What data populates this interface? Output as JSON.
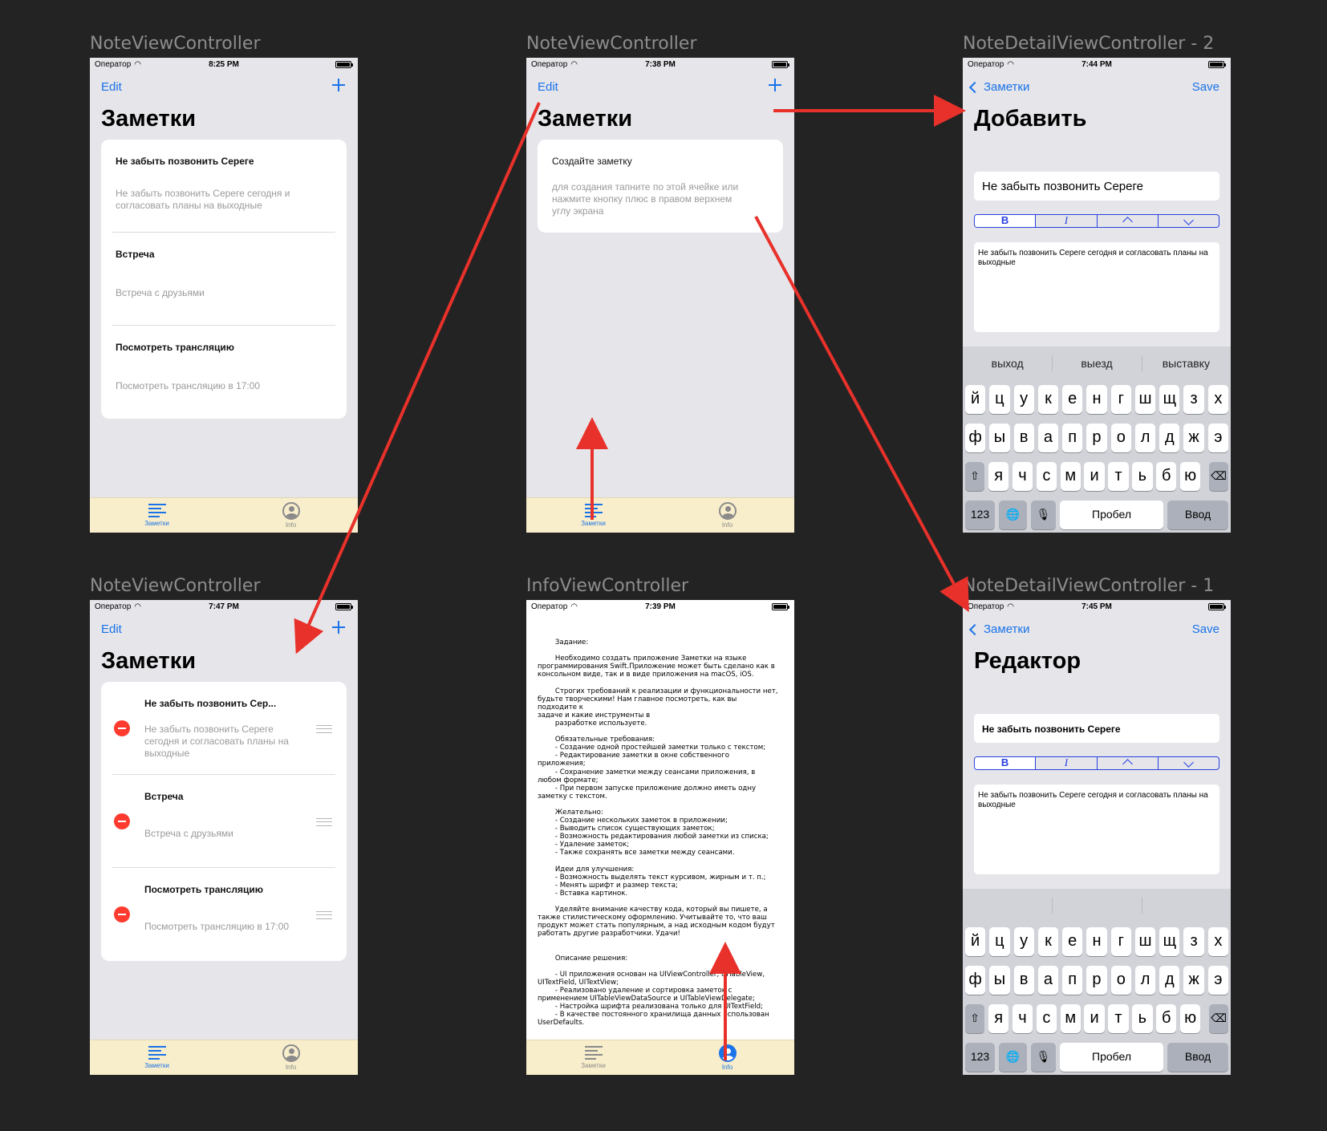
{
  "frames": {
    "f1": "NoteViewController",
    "f2": "NoteViewController",
    "f3": "NoteDetailViewController - 2",
    "f4": "NoteViewController",
    "f5": "InfoViewController",
    "f6": "NoteDetailViewController - 1"
  },
  "carrier": "Оператор",
  "times": {
    "s1": "8:25 PM",
    "s2": "7:38 PM",
    "s3": "7:44 PM",
    "s4": "7:47 PM",
    "s5": "7:39 PM",
    "s6": "7:45 PM"
  },
  "nav": {
    "edit": "Edit",
    "back": "Заметки",
    "save": "Save"
  },
  "titles": {
    "notes": "Заметки",
    "add": "Добавить",
    "editor": "Редактор"
  },
  "notes": [
    {
      "title": "Не забыть позвонить Сереге",
      "short_title": "Не забыть позвонить Сер...",
      "body": "Не забыть позвонить Сереге сегодня и согласовать планы на выходные"
    },
    {
      "title": "Встреча",
      "body": "Встреча с друзьями"
    },
    {
      "title": "Посмотреть трансляцию",
      "body": "Посмотреть трансляцию в 17:00"
    }
  ],
  "empty": {
    "title": "Создайте заметку",
    "body": "для создания тапните по этой ячейке или нажмите кнопку плюс в правом верхнем углу экрана"
  },
  "tabs": {
    "notes": "Заметки",
    "info": "Info"
  },
  "detail": {
    "title_value": "Не забыть позвонить Сереге",
    "body_value": "Не забыть позвонить Сереге сегодня и согласовать планы на выходные",
    "seg_bold": "B",
    "seg_italic": "I"
  },
  "keyboard": {
    "suggestions": [
      "выход",
      "выезд",
      "выставку"
    ],
    "row1": [
      "й",
      "ц",
      "у",
      "к",
      "е",
      "н",
      "г",
      "ш",
      "щ",
      "з",
      "х"
    ],
    "row2": [
      "ф",
      "ы",
      "в",
      "а",
      "п",
      "р",
      "о",
      "л",
      "д",
      "ж",
      "э"
    ],
    "row3": [
      "я",
      "ч",
      "с",
      "м",
      "и",
      "т",
      "ь",
      "б",
      "ю"
    ],
    "numbers": "123",
    "space": "Пробел",
    "enter": "Ввод"
  },
  "info_text": "        Задание:\n\n        Необходимо создать приложение Заметки на языке\nпрограммирования Swift.Приложение может быть сделано как в\nконсольном виде, так и в виде приложения на macOS, iOS.\n\n        Строгих требований к реализации и функциональности нет,\nбудьте творческими! Нам главное посмотреть, как вы подходите к\nзадаче и какие инструменты в\n        разработке используете.\n\n        Обязательные требования:\n        - Создание одной простейшей заметки только с текстом;\n        - Редактирование заметки в окне собственного приложения;\n        - Сохранение заметки между сеансами приложения, в\nлюбом формате;\n        - При первом запуске приложение должно иметь одну\nзаметку с текстом.\n\n        Желательно:\n        - Создание нескольких заметок в приложении;\n        - Выводить список существующих заметок;\n        - Возможность редактирования любой заметки из списка;\n        - Удаление заметок;\n        - Также сохранять все заметки между сеансами.\n\n        Идеи для улучшения:\n        - Возможность выделять текст курсивом, жирным и т. п.;\n        - Менять шрифт и размер текста;\n        - Вставка картинок.\n\n        Уделяйте внимание качеству кода, который вы пишете, а\nтакже стилистическому оформлению. Учитывайте то, что ваш\nпродукт может стать популярным, а над исходным кодом будут\nработать другие разработчики. Удачи!\n\n\n        Описание решения:\n\n        - UI приложения основан на UIViewController, UITableView,\nUITextField, UITextView;\n        - Реализовано удаление и сортировка заметок с\nприменением UITableViewDataSource и UITableViewDelegate;\n        - Настройка шрифта реализована только для UITextField;\n        - В качестве постоянного хранилища данных использован\nUserDefaults.",
  "colors": {
    "accent": "#1a73e8",
    "arrow": "#e8312a",
    "segment": "#2740e0",
    "tabbar": "#f8eecb"
  }
}
